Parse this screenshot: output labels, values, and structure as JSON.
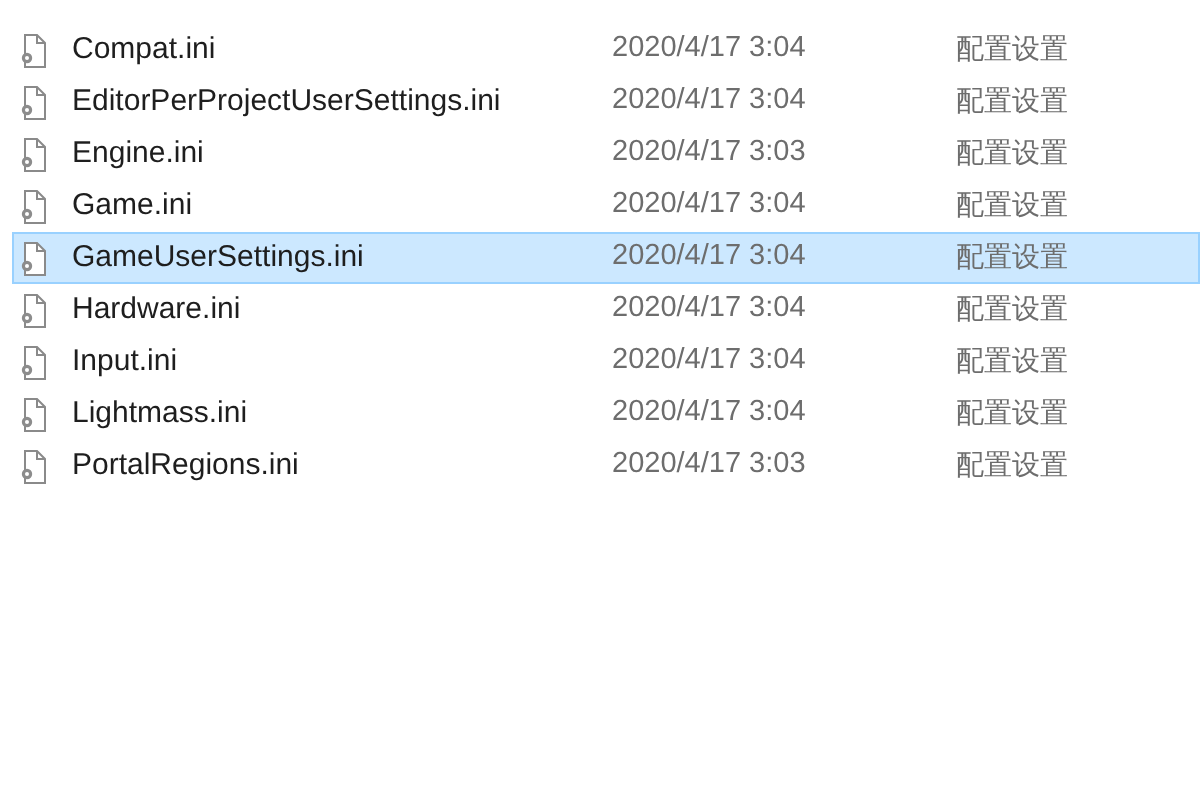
{
  "files": [
    {
      "name": "Compat.ini",
      "modified": "2020/4/17 3:04",
      "type": "配置设置",
      "selected": false
    },
    {
      "name": "EditorPerProjectUserSettings.ini",
      "modified": "2020/4/17 3:04",
      "type": "配置设置",
      "selected": false
    },
    {
      "name": "Engine.ini",
      "modified": "2020/4/17 3:03",
      "type": "配置设置",
      "selected": false
    },
    {
      "name": "Game.ini",
      "modified": "2020/4/17 3:04",
      "type": "配置设置",
      "selected": false
    },
    {
      "name": "GameUserSettings.ini",
      "modified": "2020/4/17 3:04",
      "type": "配置设置",
      "selected": true
    },
    {
      "name": "Hardware.ini",
      "modified": "2020/4/17 3:04",
      "type": "配置设置",
      "selected": false
    },
    {
      "name": "Input.ini",
      "modified": "2020/4/17 3:04",
      "type": "配置设置",
      "selected": false
    },
    {
      "name": "Lightmass.ini",
      "modified": "2020/4/17 3:04",
      "type": "配置设置",
      "selected": false
    },
    {
      "name": "PortalRegions.ini",
      "modified": "2020/4/17 3:03",
      "type": "配置设置",
      "selected": false
    }
  ]
}
